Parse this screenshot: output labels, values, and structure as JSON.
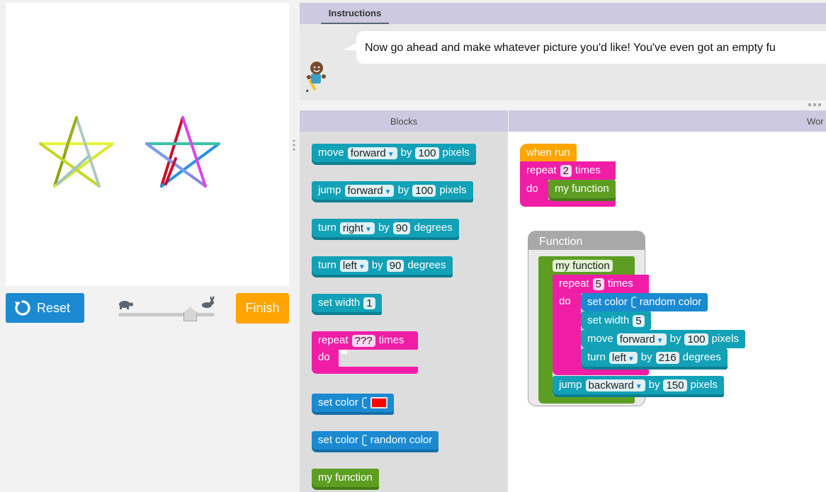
{
  "left": {
    "reset_label": "Reset",
    "finish_label": "Finish",
    "colors": {
      "reset": "#1b8ad1",
      "finish": "#ffa400"
    }
  },
  "instructions": {
    "tab_label": "Instructions",
    "text": "Now go ahead and make whatever picture you'd like! You've even got an empty fu"
  },
  "headers": {
    "blocks": "Blocks",
    "workspace": "Wor"
  },
  "toolbox": {
    "move_blk": {
      "label": "move",
      "dir": "forward",
      "by": "by",
      "amount": "100",
      "unit": "pixels"
    },
    "jump_blk": {
      "label": "jump",
      "dir": "forward",
      "by": "by",
      "amount": "100",
      "unit": "pixels"
    },
    "turn_right_blk": {
      "label": "turn",
      "dir": "right",
      "by": "by",
      "amount": "90",
      "unit": "degrees"
    },
    "turn_left_blk": {
      "label": "turn",
      "dir": "left",
      "by": "by",
      "amount": "90",
      "unit": "degrees"
    },
    "width_blk": {
      "label": "set width",
      "amount": "1"
    },
    "repeat_blk": {
      "label": "repeat",
      "amount": "???",
      "unit": "times",
      "do": "do"
    },
    "color_blk": {
      "label": "set color",
      "swatch": "#ff0000"
    },
    "color_random_blk": {
      "label": "set color",
      "value": "random color"
    },
    "function_blk": {
      "label": "my function"
    }
  },
  "workspace": {
    "when_run": "when run",
    "repeat": {
      "label": "repeat",
      "amount": "2",
      "unit": "times",
      "do": "do"
    },
    "call": "my function",
    "function_frame_title": "Function",
    "function_name": "my function",
    "inner_repeat": {
      "label": "repeat",
      "amount": "5",
      "unit": "times",
      "do": "do"
    },
    "set_color": {
      "label": "set color",
      "value": "random color"
    },
    "set_width": {
      "label": "set width",
      "amount": "5"
    },
    "move": {
      "label": "move",
      "dir": "forward",
      "by": "by",
      "amount": "100",
      "unit": "pixels"
    },
    "turn": {
      "label": "turn",
      "dir": "left",
      "by": "by",
      "amount": "216",
      "unit": "degrees"
    },
    "jump": {
      "label": "jump",
      "dir": "backward",
      "by": "by",
      "amount": "150",
      "unit": "pixels"
    }
  }
}
